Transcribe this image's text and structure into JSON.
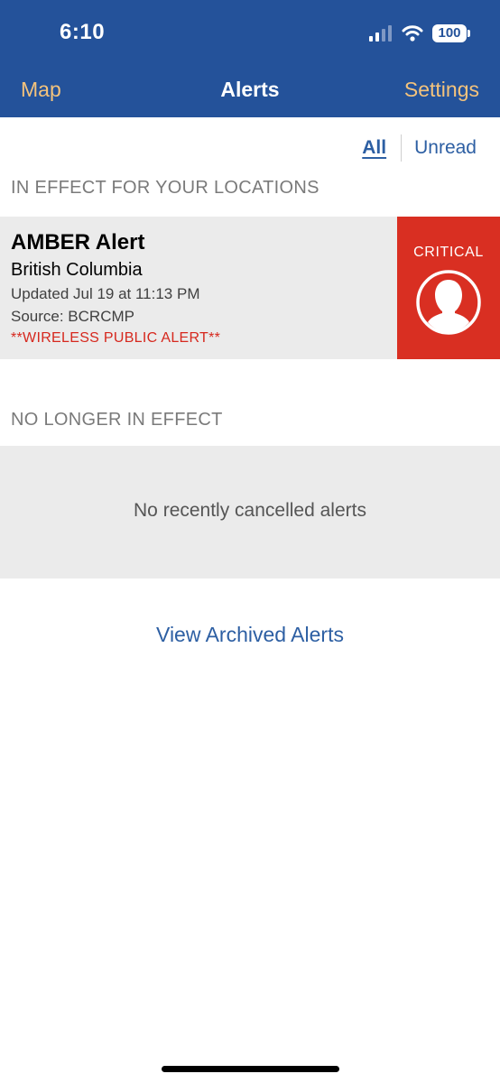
{
  "status_bar": {
    "time": "6:10",
    "battery": "100"
  },
  "nav": {
    "left": "Map",
    "title": "Alerts",
    "right": "Settings"
  },
  "filter": {
    "all": "All",
    "unread": "Unread"
  },
  "sections": {
    "in_effect": "IN EFFECT FOR YOUR LOCATIONS",
    "no_longer": "NO LONGER IN EFFECT"
  },
  "alert": {
    "title": "AMBER Alert",
    "region": "British Columbia",
    "updated": "Updated Jul 19 at 11:13 PM",
    "source": "Source: BCRCMP",
    "wireless": "**WIRELESS PUBLIC ALERT**",
    "severity": "CRITICAL",
    "severity_color": "#d92f22",
    "icon": "person-icon"
  },
  "empty": {
    "message": "No recently cancelled alerts"
  },
  "archived": {
    "label": "View Archived Alerts"
  },
  "colors": {
    "header": "#24529a",
    "nav_accent": "#f4c37c",
    "link": "#2d5fa3",
    "critical": "#d92f22"
  }
}
